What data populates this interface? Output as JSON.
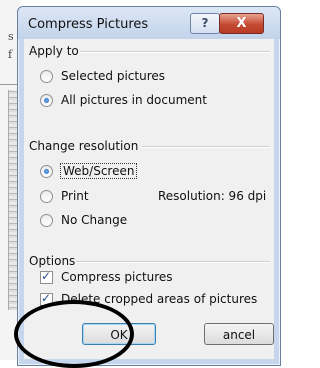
{
  "background": {
    "line1": "s",
    "line2": "f"
  },
  "dialog": {
    "title": "Compress Pictures",
    "help_label": "?",
    "close_label": "X"
  },
  "apply_to": {
    "heading": "Apply to",
    "selected_pictures": "Selected pictures",
    "all_pictures": "All pictures in document",
    "selected": "all_pictures"
  },
  "change_resolution": {
    "heading": "Change resolution",
    "web_screen": "Web/Screen",
    "print": "Print",
    "no_change": "No Change",
    "resolution_label": "Resolution:  96 dpi",
    "selected": "web_screen"
  },
  "options": {
    "heading": "Options",
    "compress_pictures": "Compress pictures",
    "delete_cropped": "Delete cropped areas of pictures",
    "compress_checked": true,
    "delete_checked": true
  },
  "buttons": {
    "ok": "OK",
    "cancel": "ancel"
  }
}
